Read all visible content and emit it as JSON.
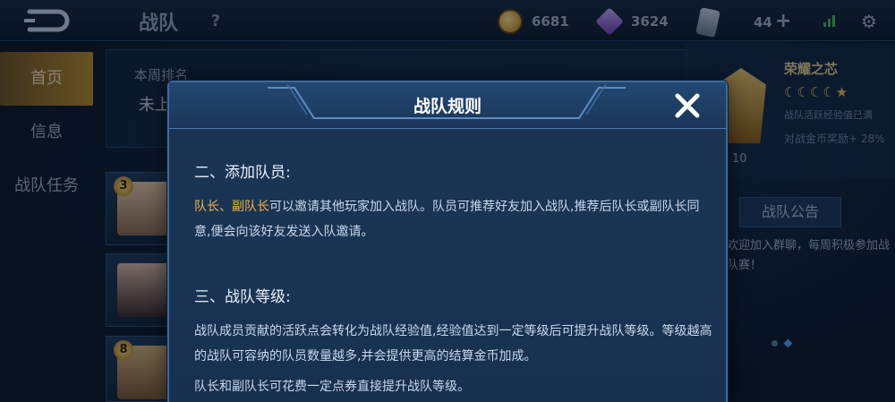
{
  "header": {
    "title": "战队",
    "help": "?",
    "coins": "6681",
    "diamonds": "3624",
    "tickets": "44",
    "add": "+",
    "settings": "⚙"
  },
  "nav": {
    "items": [
      {
        "label": "首页",
        "active": true
      },
      {
        "label": "信息",
        "active": false
      },
      {
        "label": "战队任务",
        "active": false
      }
    ]
  },
  "rank": {
    "label": "本周排名",
    "value": "未上"
  },
  "members": [
    {
      "level": "3"
    },
    {
      "level": ""
    },
    {
      "level": "8"
    }
  ],
  "tier": {
    "name": "荣耀之芯",
    "stars": "☾☾☾☾★",
    "note1": "战队活跃经验值已满",
    "note2": "对战金币奖励+  28%",
    "level": "10"
  },
  "notice": {
    "title": "战队公告",
    "text": "欢迎加入群聊，每周积极参加战队赛！"
  },
  "dialog": {
    "title": "战队规则",
    "sections": [
      {
        "heading": "二、添加队员:",
        "highlight": "队长、副队长",
        "text": "可以邀请其他玩家加入战队。队员可推荐好友加入战队,推荐后队长或副队长同意,便会向该好友发送入队邀请。"
      },
      {
        "heading": "三、战队等级:",
        "text": "战队成员贡献的活跃点会转化为战队经验值,经验值达到一定等级后可提升战队等级。等级越高的战队可容纳的队员数量越多,并会提供更高的结算金币加成。",
        "text2": "队长和副队长可花费一定点券直接提升战队等级。"
      }
    ]
  },
  "colors": {
    "highlight": "#f0b545",
    "dialog_bg": "#1a3352",
    "border": "#3d6a9c",
    "nav_active": "#b98c2e"
  }
}
